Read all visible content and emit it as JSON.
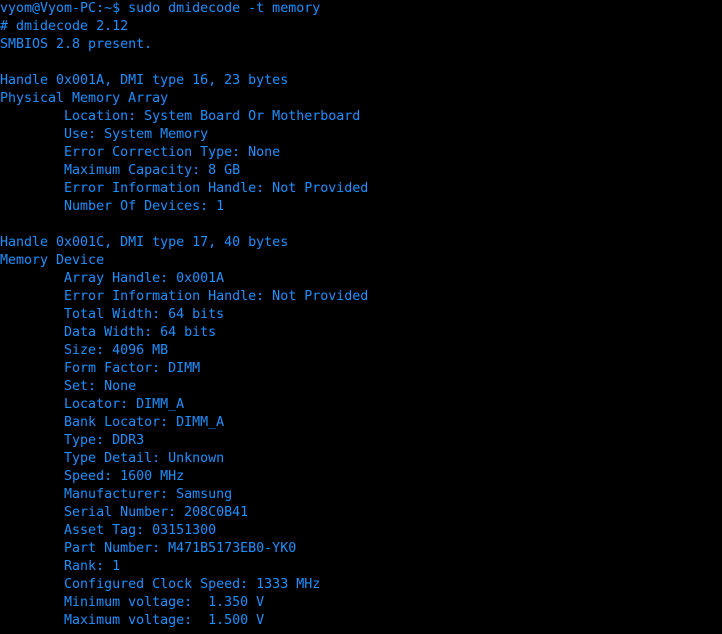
{
  "terminal": {
    "background_color": "#000000",
    "text_color": "#1e90ff",
    "prompt": "vyom@Vyom-PC:~$",
    "command": "sudo dmidecode -t memory",
    "lines": [
      "vyom@Vyom-PC:~$ sudo dmidecode -t memory",
      "# dmidecode 2.12",
      "SMBIOS 2.8 present.",
      "",
      "Handle 0x001A, DMI type 16, 23 bytes",
      "Physical Memory Array",
      "        Location: System Board Or Motherboard",
      "        Use: System Memory",
      "        Error Correction Type: None",
      "        Maximum Capacity: 8 GB",
      "        Error Information Handle: Not Provided",
      "        Number Of Devices: 1",
      "",
      "Handle 0x001C, DMI type 17, 40 bytes",
      "Memory Device",
      "        Array Handle: 0x001A",
      "        Error Information Handle: Not Provided",
      "        Total Width: 64 bits",
      "        Data Width: 64 bits",
      "        Size: 4096 MB",
      "        Form Factor: DIMM",
      "        Set: None",
      "        Locator: DIMM_A",
      "        Bank Locator: DIMM_A",
      "        Type: DDR3",
      "        Type Detail: Unknown",
      "        Speed: 1600 MHz",
      "        Manufacturer: Samsung",
      "        Serial Number: 208C0B41",
      "        Asset Tag: 03151300",
      "        Part Number: M471B5173EB0-YK0",
      "        Rank: 1",
      "        Configured Clock Speed: 1333 MHz",
      "        Minimum voltage:  1.350 V",
      "        Maximum voltage:  1.500 V"
    ],
    "dmidecode_version": "# dmidecode 2.12",
    "smbios_version": "SMBIOS 2.8 present.",
    "blocks": [
      {
        "handle": "Handle 0x001A, DMI type 16, 23 bytes",
        "title": "Physical Memory Array",
        "fields": [
          {
            "key": "Location",
            "value": "System Board Or Motherboard"
          },
          {
            "key": "Use",
            "value": "System Memory"
          },
          {
            "key": "Error Correction Type",
            "value": "None"
          },
          {
            "key": "Maximum Capacity",
            "value": "8 GB"
          },
          {
            "key": "Error Information Handle",
            "value": "Not Provided"
          },
          {
            "key": "Number Of Devices",
            "value": "1"
          }
        ]
      },
      {
        "handle": "Handle 0x001C, DMI type 17, 40 bytes",
        "title": "Memory Device",
        "fields": [
          {
            "key": "Array Handle",
            "value": "0x001A"
          },
          {
            "key": "Error Information Handle",
            "value": "Not Provided"
          },
          {
            "key": "Total Width",
            "value": "64 bits"
          },
          {
            "key": "Data Width",
            "value": "64 bits"
          },
          {
            "key": "Size",
            "value": "4096 MB"
          },
          {
            "key": "Form Factor",
            "value": "DIMM"
          },
          {
            "key": "Set",
            "value": "None"
          },
          {
            "key": "Locator",
            "value": "DIMM_A"
          },
          {
            "key": "Bank Locator",
            "value": "DIMM_A"
          },
          {
            "key": "Type",
            "value": "DDR3"
          },
          {
            "key": "Type Detail",
            "value": "Unknown"
          },
          {
            "key": "Speed",
            "value": "1600 MHz"
          },
          {
            "key": "Manufacturer",
            "value": "Samsung"
          },
          {
            "key": "Serial Number",
            "value": "208C0B41"
          },
          {
            "key": "Asset Tag",
            "value": "03151300"
          },
          {
            "key": "Part Number",
            "value": "M471B5173EB0-YK0"
          },
          {
            "key": "Rank",
            "value": "1"
          },
          {
            "key": "Configured Clock Speed",
            "value": "1333 MHz"
          },
          {
            "key": "Minimum voltage",
            "value": "1.350 V"
          },
          {
            "key": "Maximum voltage",
            "value": "1.500 V"
          }
        ]
      }
    ]
  }
}
